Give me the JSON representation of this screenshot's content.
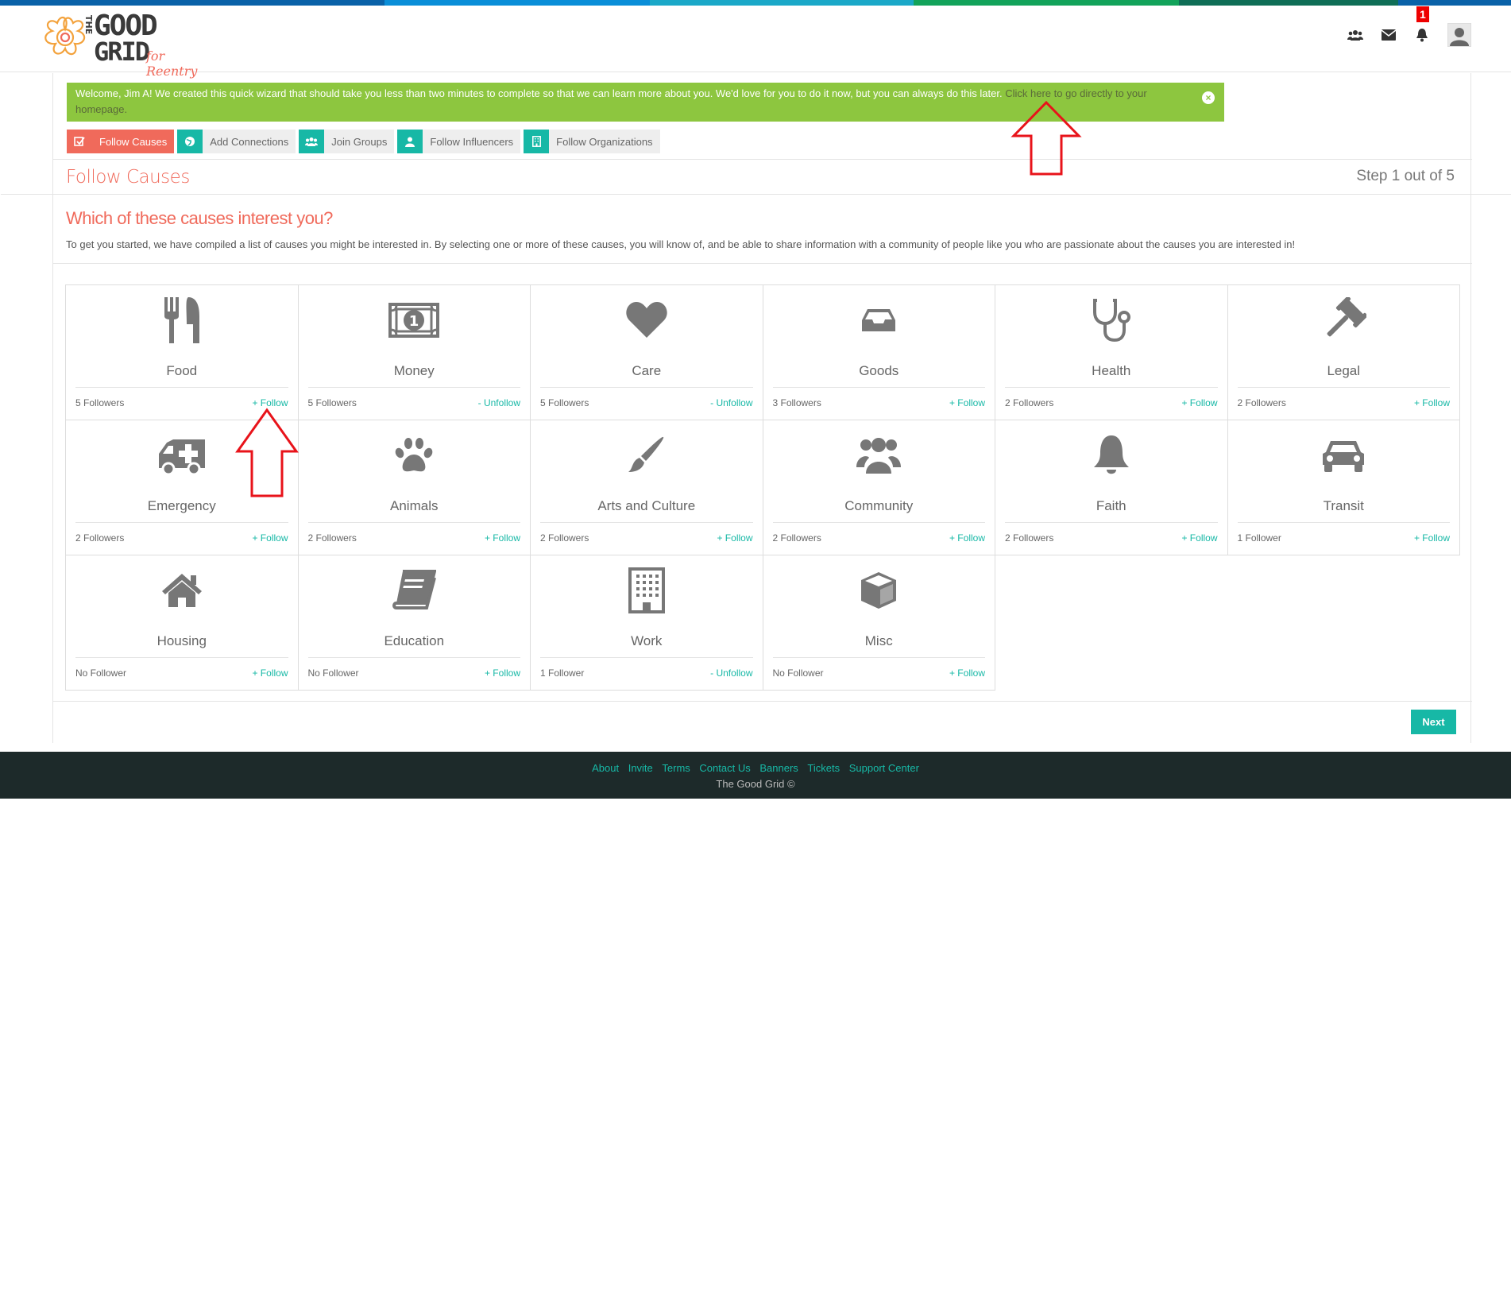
{
  "stripe_colors": [
    "#0a6bb5",
    "#0a8ed8",
    "#1aa8c8",
    "#1aa356",
    "#0e7a52",
    "#0a6bb5"
  ],
  "logo": {
    "line1": "GOOD",
    "line2": "GRID",
    "the": "THE",
    "tagline": "for Reentry"
  },
  "notifications": {
    "count": "1"
  },
  "alert": {
    "message": "Welcome, Jim A! We created this quick wizard that should take you less than two minutes to complete so that we can learn more about you. We'd love for you to do it now, but you can always do this later.",
    "link_text": "Click here to go directly to your homepage."
  },
  "steps": [
    {
      "label": "Follow Causes",
      "icon": "check-square-icon",
      "active": true
    },
    {
      "label": "Add Connections",
      "icon": "globe-icon",
      "active": false
    },
    {
      "label": "Join Groups",
      "icon": "users-icon",
      "active": false
    },
    {
      "label": "Follow Influencers",
      "icon": "user-icon",
      "active": false
    },
    {
      "label": "Follow Organizations",
      "icon": "building-icon",
      "active": false
    }
  ],
  "section": {
    "title": "Follow Causes",
    "step_count": "Step 1 out of 5"
  },
  "question": "Which of these causes interest you?",
  "intro": "To get you started, we have compiled a list of causes you might be interested in. By selecting one or more of these causes, you will know of, and be able to share information with a community of people like you who are passionate about the causes you are interested in!",
  "causes": [
    {
      "name": "Food",
      "followers": "5 Followers",
      "action": "+ Follow",
      "icon": "utensils-icon"
    },
    {
      "name": "Money",
      "followers": "5 Followers",
      "action": "- Unfollow",
      "icon": "money-icon"
    },
    {
      "name": "Care",
      "followers": "5 Followers",
      "action": "- Unfollow",
      "icon": "heart-icon"
    },
    {
      "name": "Goods",
      "followers": "3 Followers",
      "action": "+ Follow",
      "icon": "inbox-icon"
    },
    {
      "name": "Health",
      "followers": "2 Followers",
      "action": "+ Follow",
      "icon": "stethoscope-icon"
    },
    {
      "name": "Legal",
      "followers": "2 Followers",
      "action": "+ Follow",
      "icon": "gavel-icon"
    },
    {
      "name": "Emergency",
      "followers": "2 Followers",
      "action": "+ Follow",
      "icon": "ambulance-icon"
    },
    {
      "name": "Animals",
      "followers": "2 Followers",
      "action": "+ Follow",
      "icon": "paw-icon"
    },
    {
      "name": "Arts and Culture",
      "followers": "2 Followers",
      "action": "+ Follow",
      "icon": "paintbrush-icon"
    },
    {
      "name": "Community",
      "followers": "2 Followers",
      "action": "+ Follow",
      "icon": "community-icon"
    },
    {
      "name": "Faith",
      "followers": "2 Followers",
      "action": "+ Follow",
      "icon": "bell-icon"
    },
    {
      "name": "Transit",
      "followers": "1 Follower",
      "action": "+ Follow",
      "icon": "car-icon"
    },
    {
      "name": "Housing",
      "followers": "No Follower",
      "action": "+ Follow",
      "icon": "home-icon"
    },
    {
      "name": "Education",
      "followers": "No Follower",
      "action": "+ Follow",
      "icon": "book-icon"
    },
    {
      "name": "Work",
      "followers": "1 Follower",
      "action": "- Unfollow",
      "icon": "office-building-icon"
    },
    {
      "name": "Misc",
      "followers": "No Follower",
      "action": "+ Follow",
      "icon": "cube-icon"
    }
  ],
  "next_label": "Next",
  "footer": {
    "links": [
      "About",
      "Invite",
      "Terms",
      "Contact Us",
      "Banners",
      "Tickets",
      "Support Center"
    ],
    "copyright": "The Good Grid ©"
  },
  "colors": {
    "accent": "#17b8a6",
    "coral": "#f06a5b",
    "alert_green": "#8dc63f",
    "footer_bg": "#1d2a2a",
    "icon_gray": "#777777"
  }
}
